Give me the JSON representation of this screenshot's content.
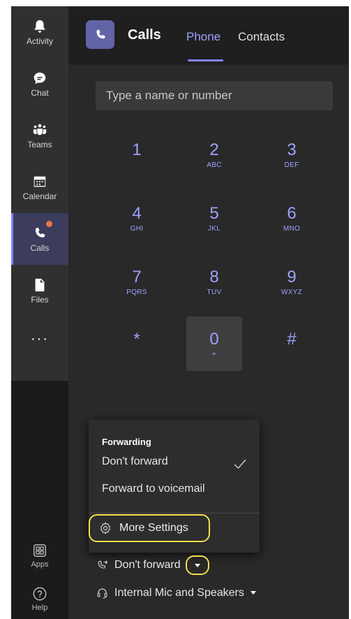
{
  "rail": {
    "items": [
      {
        "label": "Activity",
        "icon": "bell-icon"
      },
      {
        "label": "Chat",
        "icon": "chat-icon"
      },
      {
        "label": "Teams",
        "icon": "teams-icon"
      },
      {
        "label": "Calendar",
        "icon": "calendar-icon"
      },
      {
        "label": "Calls",
        "icon": "phone-icon",
        "active": true,
        "badge": true
      },
      {
        "label": "Files",
        "icon": "file-icon"
      }
    ],
    "more": "···",
    "bottom": [
      {
        "label": "Apps",
        "icon": "apps-icon"
      },
      {
        "label": "Help",
        "icon": "help-icon"
      }
    ]
  },
  "header": {
    "title": "Calls",
    "tabs": [
      {
        "label": "Phone",
        "active": true
      },
      {
        "label": "Contacts",
        "active": false
      }
    ]
  },
  "dialpad": {
    "placeholder": "Type a name or number",
    "keys": [
      {
        "digit": "1",
        "letters": ""
      },
      {
        "digit": "2",
        "letters": "ABC"
      },
      {
        "digit": "3",
        "letters": "DEF"
      },
      {
        "digit": "4",
        "letters": "GHI"
      },
      {
        "digit": "5",
        "letters": "JKL"
      },
      {
        "digit": "6",
        "letters": "MNO"
      },
      {
        "digit": "7",
        "letters": "PQRS"
      },
      {
        "digit": "8",
        "letters": "TUV"
      },
      {
        "digit": "9",
        "letters": "WXYZ"
      },
      {
        "digit": "*",
        "letters": ""
      },
      {
        "digit": "0",
        "letters": "+"
      },
      {
        "digit": "#",
        "letters": ""
      }
    ]
  },
  "forwarding_menu": {
    "heading": "Forwarding",
    "options": [
      {
        "label": "Don't forward",
        "checked": true
      },
      {
        "label": "Forward to voicemail",
        "checked": false
      }
    ],
    "more_settings": "More Settings"
  },
  "bottom": {
    "forward_label": "Don't forward",
    "device_label": "Internal Mic and Speakers"
  },
  "colors": {
    "accent": "#7f85f5",
    "highlight_ring": "#f0e04b",
    "badge": "#e97548"
  }
}
